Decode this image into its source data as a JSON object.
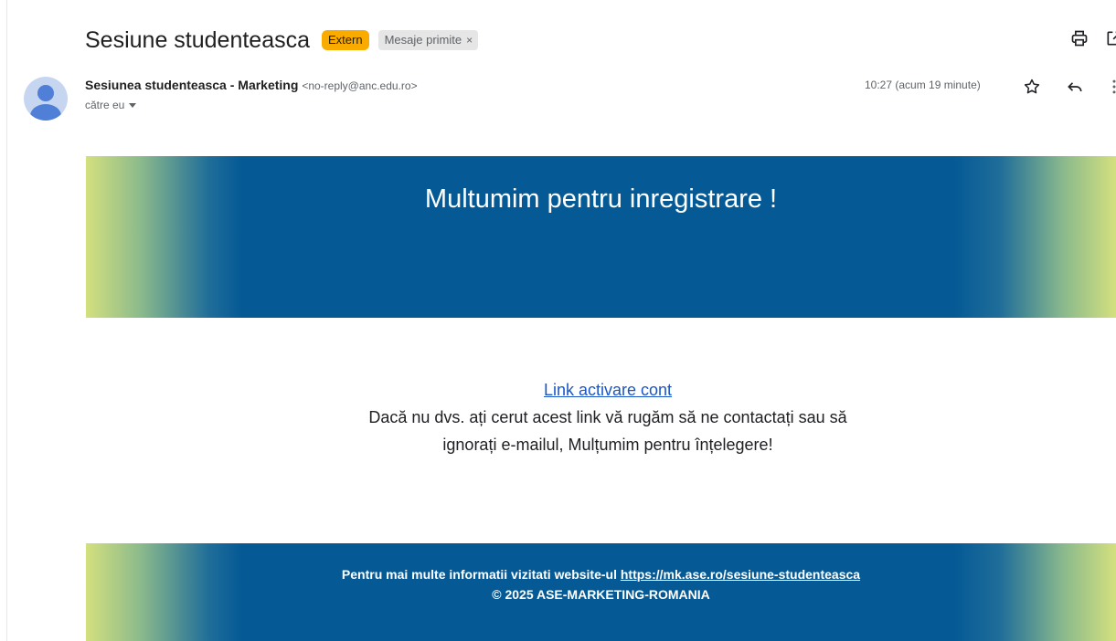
{
  "email": {
    "subject": "Sesiune studenteasca",
    "labels": {
      "extern": "Extern",
      "inbox": "Mesaje primite",
      "inbox_close": "×"
    },
    "sender": {
      "name": "Sesiunea studenteasca - Marketing",
      "email": "<no-reply@anc.edu.ro>",
      "to": "către eu"
    },
    "time": "10:27 (acum 19 minute)",
    "icons": [
      "print-icon",
      "open-in-new-window-icon",
      "star-icon",
      "reply-icon",
      "more-vert-icon"
    ]
  },
  "body": {
    "banner_title": "Multumim pentru inregistrare !",
    "link_text": "Link activare cont",
    "message": "Dacă nu dvs. ați cerut acest link vă rugăm să ne contactați sau să ignorați e-mailul, Mulțumim pentru înțelegere!",
    "footer": {
      "prefix": "Pentru mai multe informatii vizitati website-ul",
      "url": "https://mk.ase.ro/sesiune-studenteasca",
      "copyright": "© 2025 ASE-MARKETING-ROMANIA"
    }
  },
  "colors": {
    "banner_blue": "#055a96",
    "banner_green": "#d4e07e",
    "extern_badge": "#f9ab00",
    "link": "#1a56c9"
  }
}
